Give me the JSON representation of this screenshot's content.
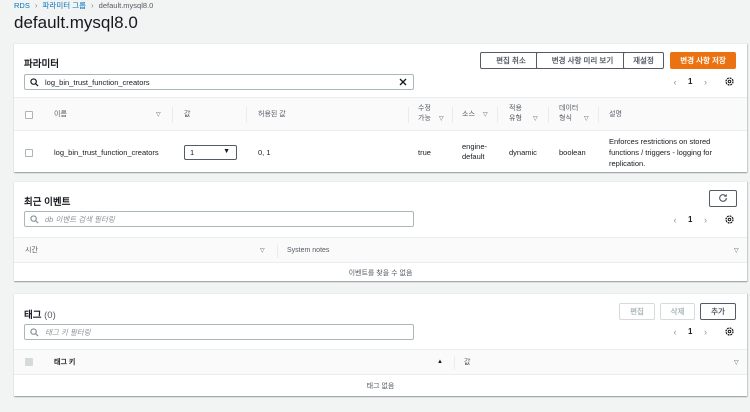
{
  "breadcrumb": {
    "items": [
      "RDS",
      "파라미터 그룹",
      "default.mysql8.0"
    ]
  },
  "page_title": "default.mysql8.0",
  "parameters": {
    "title": "파라미터",
    "buttons": {
      "cancel": "편집 취소",
      "preview": "변경 사항 미리 보기",
      "reset": "재설정",
      "save": "변경 사항 저장"
    },
    "search_value": "log_bin_trust_function_creators",
    "page": "1",
    "columns": {
      "name": "이름",
      "value": "값",
      "allowed": "허용된 값",
      "modifiable_1": "수정",
      "modifiable_2": "가능",
      "source": "소스",
      "apply_1": "적용",
      "apply_2": "유형",
      "datatype_1": "데이터",
      "datatype_2": "형식",
      "description": "설명"
    },
    "row": {
      "name": "log_bin_trust_function_creators",
      "value": "1",
      "allowed": "0, 1",
      "modifiable": "true",
      "source_1": "engine-",
      "source_2": "default",
      "apply_type": "dynamic",
      "datatype": "boolean",
      "desc_1": "Enforces restrictions on stored",
      "desc_2": "functions / triggers - logging for",
      "desc_3": "replication."
    }
  },
  "events": {
    "title": "최근 이벤트",
    "search_placeholder": "db 이벤트 검색 필터링",
    "page": "1",
    "columns": {
      "time": "시간",
      "notes": "System notes"
    },
    "empty": "이벤트를 찾을 수 없음"
  },
  "tags": {
    "title": "태그",
    "count": "(0)",
    "buttons": {
      "edit": "편집",
      "delete": "삭제",
      "add": "추가"
    },
    "search_placeholder": "태그 키 필터링",
    "page": "1",
    "columns": {
      "key": "태그 키",
      "value": "값"
    },
    "empty": "태그 없음"
  },
  "colors": {
    "primary": "#ec7211",
    "link": "#0073bb",
    "text": "#16191f",
    "muted": "#545b64"
  },
  "icons": [
    "search-icon",
    "clear-icon",
    "gear-icon",
    "refresh-icon",
    "chevron-left-icon",
    "chevron-right-icon",
    "caret-down-icon",
    "sort-up-icon"
  ]
}
